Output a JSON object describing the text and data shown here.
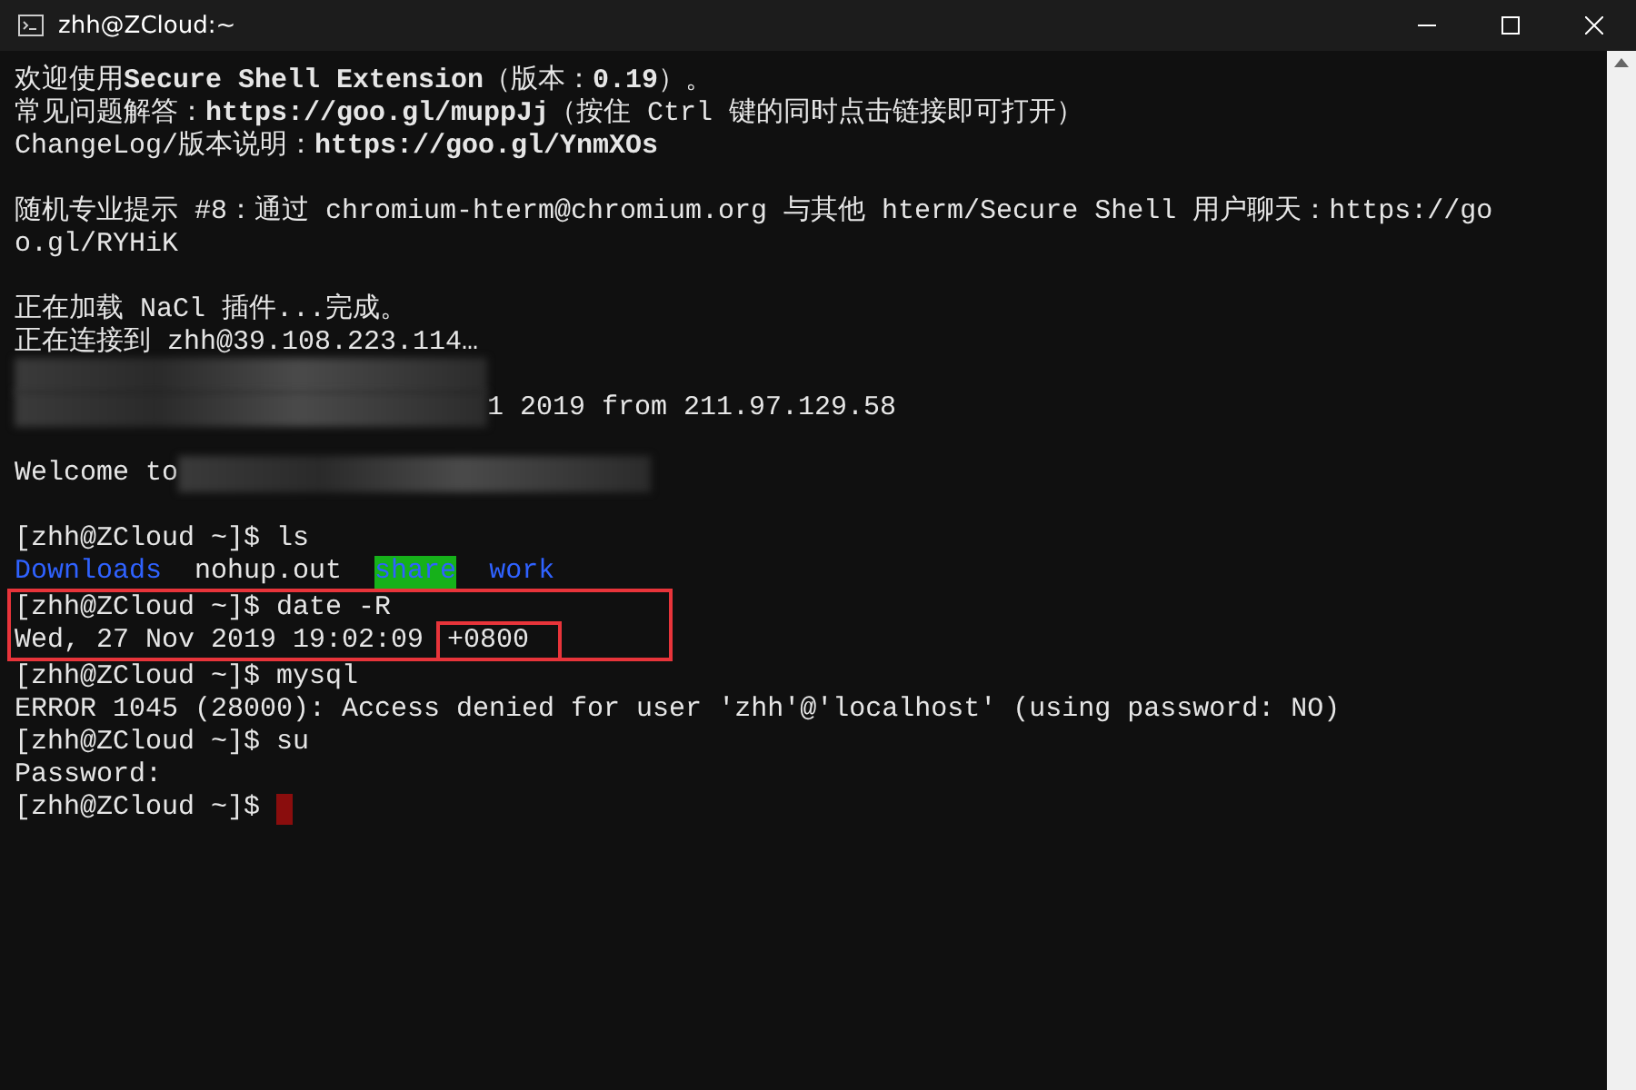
{
  "window": {
    "title": "zhh@ZCloud:~"
  },
  "lines": [
    {
      "kind": "text",
      "segments": [
        {
          "kind": "plain",
          "text": "欢迎使用"
        },
        {
          "kind": "bold",
          "text": "Secure Shell Extension"
        },
        {
          "kind": "plain",
          "text": "（版本："
        },
        {
          "kind": "bold",
          "text": "0.19"
        },
        {
          "kind": "plain",
          "text": "）。"
        }
      ]
    },
    {
      "kind": "text",
      "segments": [
        {
          "kind": "plain",
          "text": "常见问题解答："
        },
        {
          "kind": "bold",
          "text": "https://goo.gl/muppJj"
        },
        {
          "kind": "plain",
          "text": "（按住 Ctrl 键的同时点击链接即可打开）"
        }
      ]
    },
    {
      "kind": "text",
      "segments": [
        {
          "kind": "plain",
          "text": "ChangeLog/版本说明："
        },
        {
          "kind": "bold",
          "text": "https://goo.gl/YnmXOs"
        }
      ]
    },
    {
      "kind": "blank"
    },
    {
      "kind": "text",
      "segments": [
        {
          "kind": "plain",
          "text": "随机专业提示 #8：通过 chromium-hterm@chromium.org 与其他 hterm/Secure Shell 用户聊天：https://go"
        }
      ]
    },
    {
      "kind": "text",
      "segments": [
        {
          "kind": "plain",
          "text": "o.gl/RYHiK"
        }
      ]
    },
    {
      "kind": "blank"
    },
    {
      "kind": "text",
      "segments": [
        {
          "kind": "plain",
          "text": "正在加载 NaCl 插件...完成。"
        }
      ]
    },
    {
      "kind": "text",
      "segments": [
        {
          "kind": "plain",
          "text": "正在连接到 zhh@39.108.223.114…"
        }
      ]
    },
    {
      "kind": "text",
      "segments": [
        {
          "kind": "blur"
        }
      ]
    },
    {
      "kind": "text",
      "segments": [
        {
          "kind": "blur"
        },
        {
          "kind": "plain",
          "text": "1 2019 from 211.97.129.58"
        }
      ]
    },
    {
      "kind": "blank"
    },
    {
      "kind": "text",
      "segments": [
        {
          "kind": "plain",
          "text": "Welcome to"
        },
        {
          "kind": "blur"
        }
      ]
    },
    {
      "kind": "blank"
    },
    {
      "kind": "text",
      "segments": [
        {
          "kind": "plain",
          "text": "[zhh@ZCloud ~]$ ls"
        }
      ]
    },
    {
      "kind": "text",
      "segments": [
        {
          "kind": "dir",
          "text": "Downloads"
        },
        {
          "kind": "plain",
          "text": "  nohup.out  "
        },
        {
          "kind": "dir-highlight",
          "text": "share"
        },
        {
          "kind": "dir",
          "text": "work"
        }
      ]
    },
    {
      "kind": "text",
      "framed": true,
      "segments": [
        {
          "kind": "plain",
          "text": "[zhh@ZCloud ~]$ date -R"
        }
      ]
    },
    {
      "kind": "text",
      "framed": true,
      "segments": [
        {
          "kind": "plain",
          "text": "Wed, 27 Nov 2019 19:02:09 "
        },
        {
          "kind": "boxed",
          "text": "+0800"
        }
      ]
    },
    {
      "kind": "text",
      "segments": [
        {
          "kind": "plain",
          "text": "[zhh@ZCloud ~]$ mysql"
        }
      ]
    },
    {
      "kind": "text",
      "segments": [
        {
          "kind": "plain",
          "text": "ERROR 1045 (28000): Access denied for user 'zhh'@'localhost' (using password: NO)"
        }
      ]
    },
    {
      "kind": "text",
      "segments": [
        {
          "kind": "plain",
          "text": "[zhh@ZCloud ~]$ su"
        }
      ]
    },
    {
      "kind": "text",
      "segments": [
        {
          "kind": "plain",
          "text": "Password:"
        }
      ]
    },
    {
      "kind": "text",
      "cursor": true,
      "segments": [
        {
          "kind": "plain",
          "text": "[zhh@ZCloud ~]$ "
        }
      ]
    }
  ]
}
